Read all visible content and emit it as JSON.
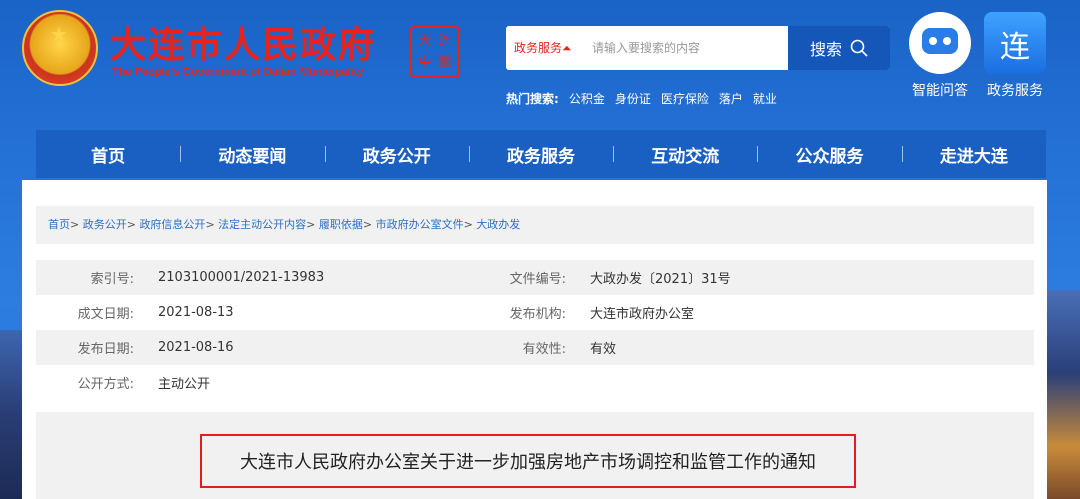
{
  "header": {
    "title_cn": "大连市人民政府",
    "title_en": "The People's Government of Dalian Municipality",
    "seal_text": "大连中國",
    "search": {
      "category": "政务服务",
      "placeholder": "请输入要搜索的内容",
      "button_label": "搜索"
    },
    "hot_search": {
      "label": "热门搜索:",
      "items": [
        "公积金",
        "身份证",
        "医疗保险",
        "落户",
        "就业"
      ]
    },
    "quick_links": [
      {
        "label": "智能问答",
        "icon": "robot-icon"
      },
      {
        "label": "政务服务",
        "icon": "service-icon"
      }
    ]
  },
  "nav": {
    "items": [
      "首页",
      "动态要闻",
      "政务公开",
      "政务服务",
      "互动交流",
      "公众服务",
      "走进大连"
    ]
  },
  "breadcrumb": {
    "items": [
      "首页",
      "政务公开",
      "政府信息公开",
      "法定主动公开内容",
      "履职依据",
      "市政府办公室文件",
      "大政办发"
    ]
  },
  "meta": {
    "index_label": "索引号:",
    "index_value": "2103100001/2021-13983",
    "doc_no_label": "文件编号:",
    "doc_no_value": "大政办发〔2021〕31号",
    "date_label": "成文日期:",
    "date_value": "2021-08-13",
    "org_label": "发布机构:",
    "org_value": "大连市政府办公室",
    "publish_label": "发布日期:",
    "publish_value": "2021-08-16",
    "valid_label": "有效性:",
    "valid_value": "有效",
    "open_label": "公开方式:",
    "open_value": "主动公开"
  },
  "document": {
    "title": "大连市人民政府办公室关于进一步加强房地产市场调控和监管工作的通知"
  },
  "colors": {
    "brand_red": "#e8231d",
    "nav_blue": "#1a5fc2",
    "highlight_border": "#e21d1d"
  }
}
